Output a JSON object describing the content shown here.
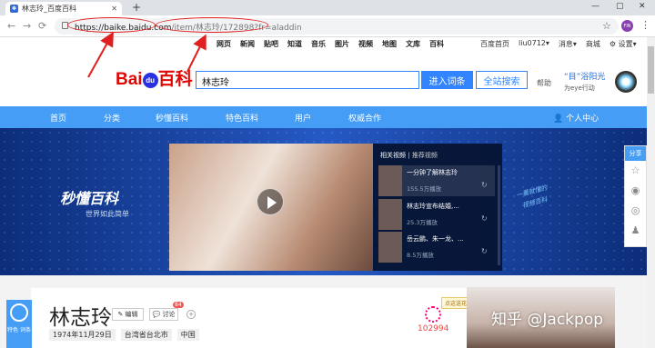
{
  "browser": {
    "tab_title": "林志玲_百度百科",
    "tab_icon": "paw-icon",
    "new_tab": "+",
    "window_controls": [
      "—",
      "▢",
      "✕"
    ],
    "url_host": "https://baike.baidu.com",
    "url_path": "/item/林志玲/172898?fr=aladdin",
    "profile_initials": "FIN"
  },
  "top_links": [
    "网页",
    "新闻",
    "贴吧",
    "知道",
    "音乐",
    "图片",
    "视频",
    "地图",
    "文库",
    "百科"
  ],
  "user_links": [
    "百度首页",
    "liu0712▾",
    "消息▾",
    "商城",
    "⚙ 设置▾"
  ],
  "logo": {
    "part1": "Bai",
    "paw": "du",
    "part2": "百科"
  },
  "search": {
    "value": "林志玲",
    "enter_button": "进入词条",
    "all_button": "全站搜索",
    "help": "帮助"
  },
  "promo": {
    "title": "“目”浴阳光",
    "subtitle": "为eye行动"
  },
  "nav": [
    "首页",
    "分类",
    "秒懂百科",
    "特色百科",
    "用户",
    "权威合作",
    "👤 个人中心"
  ],
  "banner": {
    "logo": "秒懂百科",
    "slogan": "世界如此简单",
    "video_tabs": [
      "相关视频",
      "推荐视频"
    ],
    "videos": [
      {
        "title": "一分钟了解林志玲",
        "plays": "155.5万播放"
      },
      {
        "title": "林志玲宣布结婚,...",
        "plays": "25.3万播放"
      },
      {
        "title": "岳云鹏、朱一龙、...",
        "plays": "8.5万播放"
      }
    ],
    "handwriting": [
      "一看就懂的",
      "视频百科"
    ]
  },
  "share": {
    "header": "分享",
    "icons": [
      "star-icon",
      "weibo-icon",
      "wechat-icon",
      "qq-icon"
    ]
  },
  "entry": {
    "feature_label": "特色\n词条",
    "name": "林志玲",
    "edit": "✎ 编辑",
    "discuss": "💬 讨论",
    "discuss_count": "84",
    "plus": "+",
    "meta": [
      "1974年11月29日",
      "台湾省台北市",
      "中国"
    ],
    "likes": "102994",
    "like_tip": "点这送花"
  },
  "watermark": "知乎 @Jackpop",
  "colors": {
    "accent": "#459df5",
    "baidu_red": "#e10602",
    "baidu_blue": "#2932e1",
    "annotation_red": "#e02020"
  }
}
